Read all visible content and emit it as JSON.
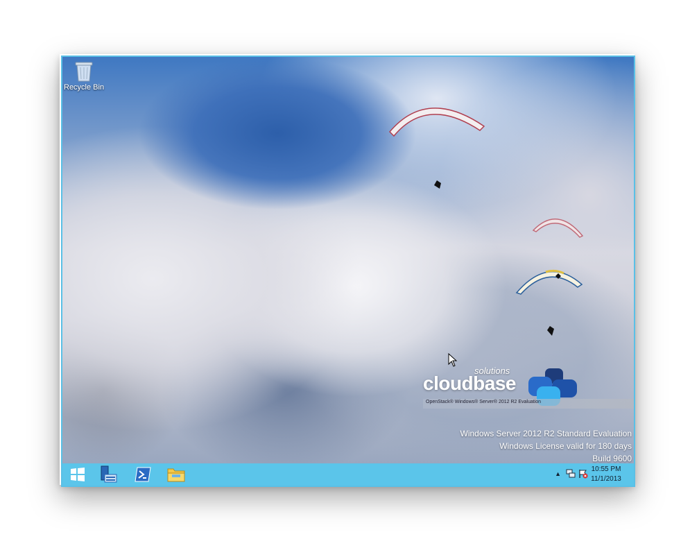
{
  "desktop": {
    "icons": [
      {
        "label": "Recycle Bin",
        "icon": "recycle-bin-icon"
      }
    ]
  },
  "branding": {
    "small": "solutions",
    "big": "cloudbase",
    "sub": "OpenStack® Windows® Server® 2012 R2 Evaluation",
    "accent": "#2e7fd6"
  },
  "watermark": {
    "line1": "Windows Server 2012 R2 Standard Evaluation",
    "line2": "Windows License valid for 180 days",
    "line3": "Build 9600"
  },
  "taskbar": {
    "color": "#5bc5ea",
    "buttons": [
      {
        "icon": "windows-start-icon"
      },
      {
        "icon": "server-manager-icon"
      },
      {
        "icon": "powershell-icon"
      },
      {
        "icon": "file-explorer-icon"
      }
    ],
    "tray": {
      "icons": [
        "show-hidden-icons-chevron",
        "network-icon",
        "action-center-flag-icon"
      ],
      "time": "10:55 PM",
      "date": "11/1/2013"
    }
  }
}
